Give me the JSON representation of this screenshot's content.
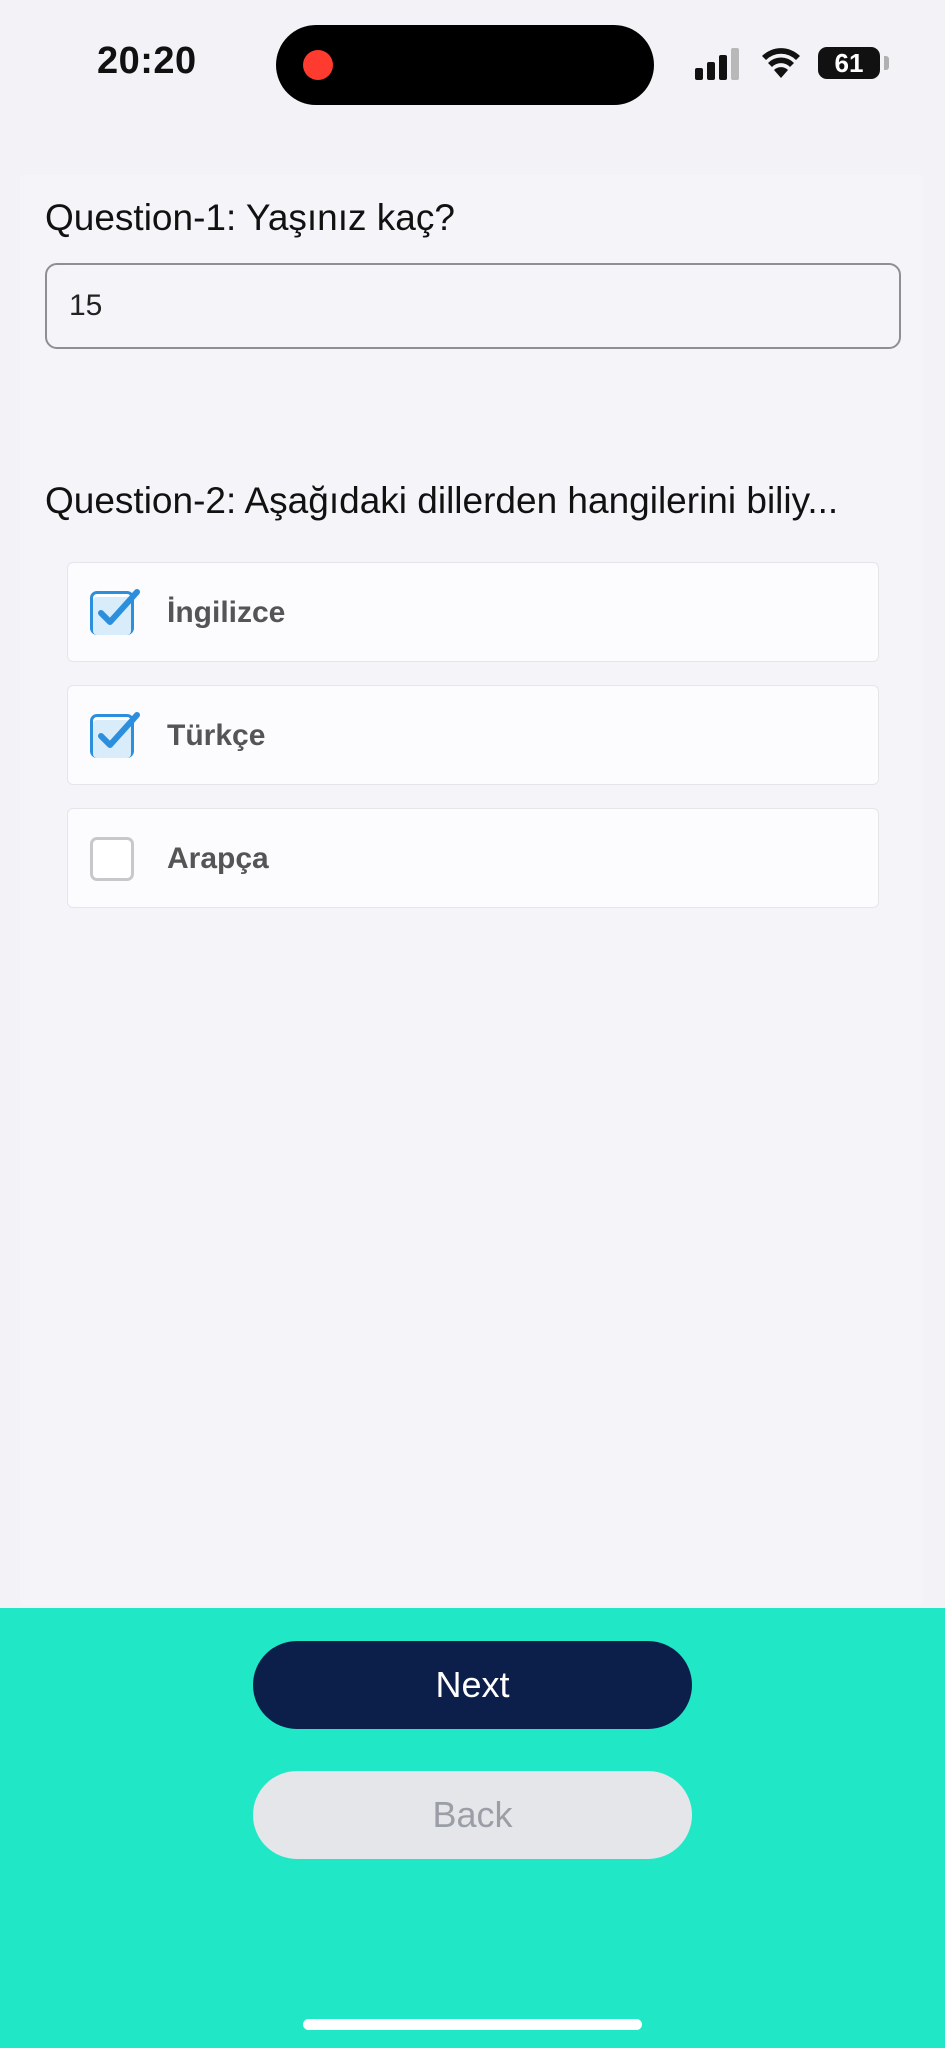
{
  "status_bar": {
    "time": "20:20",
    "battery": "61",
    "recording_color": "#ff3b30"
  },
  "questions": [
    {
      "title": "Question-1: Yaşınız kaç?",
      "answer_value": "15"
    },
    {
      "title": "Question-2: Aşağıdaki dillerden hangilerini biliy...",
      "options": [
        {
          "label": "İngilizce",
          "checked": true
        },
        {
          "label": "Türkçe",
          "checked": true
        },
        {
          "label": "Arapça",
          "checked": false
        }
      ]
    }
  ],
  "buttons": {
    "next_label": "Next",
    "back_label": "Back"
  },
  "colors": {
    "accent_checkbox": "#2b8fdd",
    "bottom_bar": "#20e8c6",
    "next_button": "#0c1e4a"
  }
}
